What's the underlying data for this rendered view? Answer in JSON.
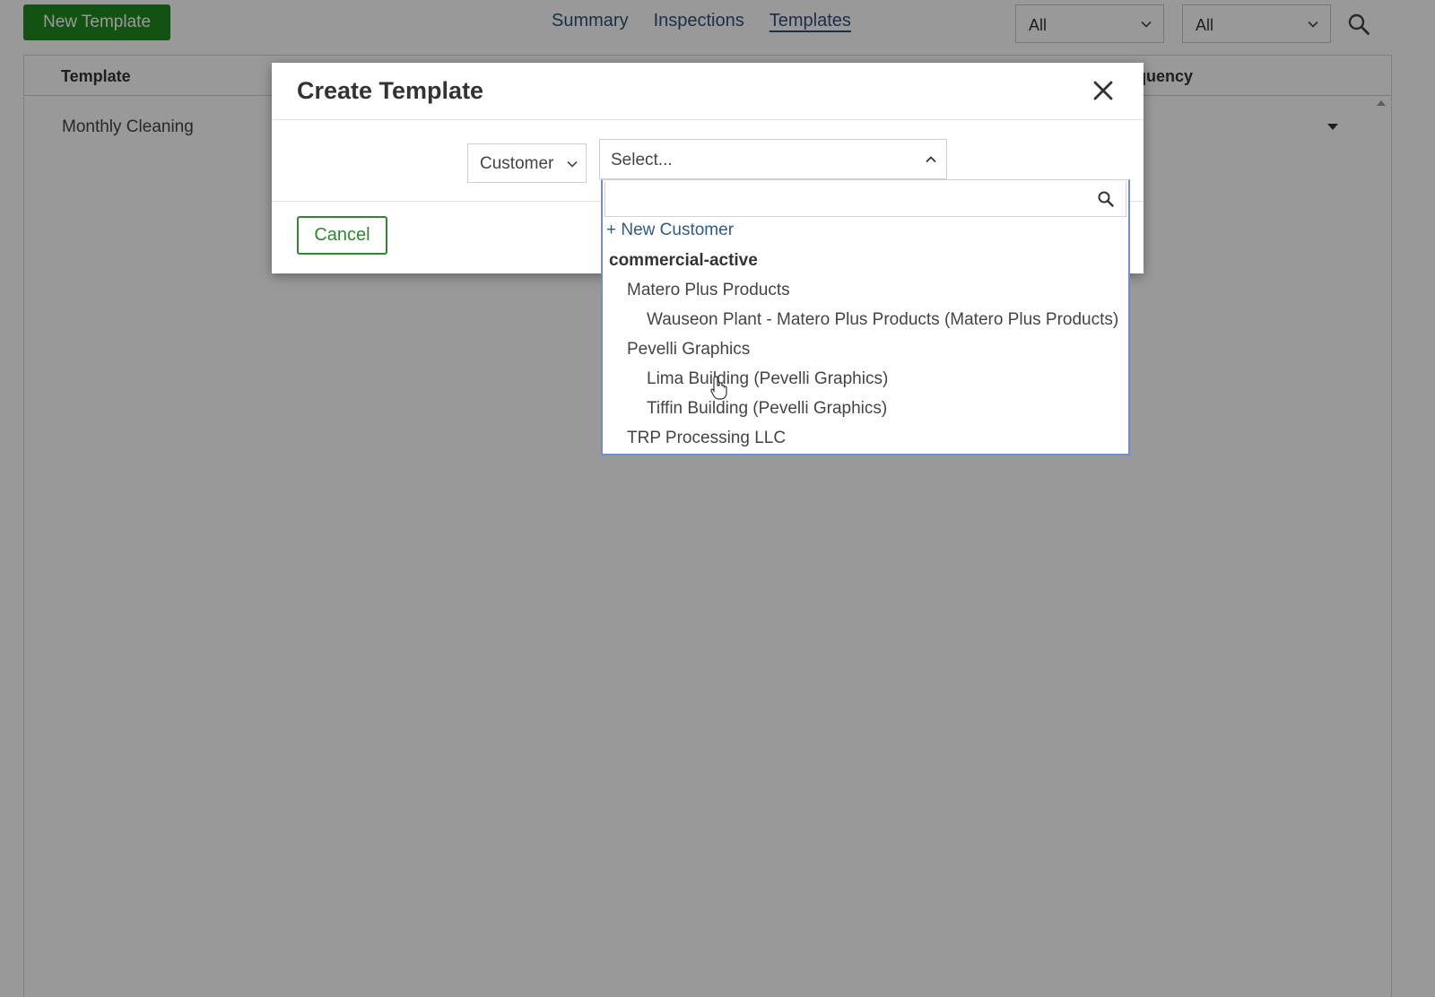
{
  "topbar": {
    "new_template_label": "New Template",
    "nav": [
      {
        "label": "Summary"
      },
      {
        "label": "Inspections"
      },
      {
        "label": "Templates",
        "active": true
      }
    ],
    "filter1": "All",
    "filter2": "All"
  },
  "table": {
    "col_template": "Template",
    "col_frequency": "equency",
    "rows": [
      {
        "template": "Monthly Cleaning"
      }
    ]
  },
  "modal": {
    "title": "Create Template",
    "type_select_value": "Customer",
    "customer_select_placeholder": "Select...",
    "cancel_label": "Cancel"
  },
  "dropdown": {
    "search_value": "",
    "new_customer_label": "+ New Customer",
    "group_label": "commercial-active",
    "items": [
      {
        "label": "Matero Plus Products",
        "level": 1
      },
      {
        "label": "Wauseon Plant - Matero Plus Products (Matero Plus Products)",
        "level": 2
      },
      {
        "label": "Pevelli Graphics",
        "level": 1
      },
      {
        "label": "Lima Building (Pevelli Graphics)",
        "level": 2
      },
      {
        "label": "Tiffin Building (Pevelli Graphics)",
        "level": 2
      },
      {
        "label": "TRP Processing LLC",
        "level": 1
      }
    ]
  },
  "colors": {
    "primary_green": "#1f8a1f",
    "nav_blue": "#2f4f7a",
    "dropdown_border": "#6f8fc8"
  }
}
